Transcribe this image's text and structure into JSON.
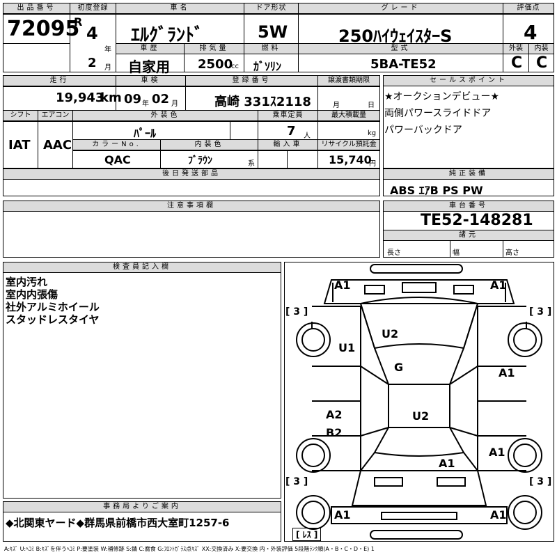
{
  "header": {
    "lot_label": "出品番号",
    "lot_number": "72095",
    "first_reg_label": "初度登録",
    "era": "R",
    "year": "4",
    "year_unit": "年",
    "month": "2",
    "month_unit": "月",
    "car_name_label": "車名",
    "car_name": "ｴﾙｸﾞﾗﾝﾄﾞ",
    "door_label": "ドア形状",
    "door": "5W",
    "grade_label": "グレード",
    "grade": "250ﾊｲｳｪｲｽﾀｰS",
    "score_label": "評価点",
    "score": "4",
    "history_label": "車歴",
    "history": "自家用",
    "displacement_label": "排気量",
    "displacement": "2500",
    "displacement_unit": "cc",
    "fuel_label": "燃料",
    "fuel": "ｶﾞｿﾘﾝ",
    "model_label": "型式",
    "model": "5BA-TE52",
    "exterior_label": "外装",
    "exterior": "C",
    "interior_label": "内装",
    "interior": "C"
  },
  "row2": {
    "mileage_label": "走行",
    "mileage": "19,943",
    "mileage_unit": "km",
    "inspection_label": "車検",
    "insp_year": "09",
    "insp_year_unit": "年",
    "insp_month": "02",
    "insp_month_unit": "月",
    "plate_label": "登録番号",
    "plate": "高崎 331ｽ2118",
    "transfer_label": "譲渡書類期限",
    "transfer_month": "月",
    "transfer_day": "日",
    "shift_label": "シフト",
    "shift": "IAT",
    "ac_label": "エアコン",
    "ac": "AAC",
    "color_label": "外装色",
    "color": "ﾊﾟｰﾙ",
    "capacity_label": "乗車定員",
    "capacity": "7",
    "capacity_unit": "人",
    "load_label": "最大積載量",
    "load_unit": "kg",
    "color_no_label": "カラーNo.",
    "color_no": "QAC",
    "int_color_label": "内装色",
    "int_color": "ﾌﾞﾗｳﾝ",
    "int_color_unit": "系",
    "import_label": "輸入車",
    "recycle_label": "リサイクル預託金",
    "recycle": "15,740",
    "recycle_unit": "円"
  },
  "sales": {
    "label": "セールスポイント",
    "lines": [
      "★オークションデビュー★",
      "両側パワースライドドア",
      "パワーバックドア"
    ]
  },
  "later_parts_label": "後日発送部品",
  "equipment": {
    "label": "純正装備",
    "value": "ABS ｴｱB PS PW"
  },
  "notes_label": "注意事項欄",
  "chassis": {
    "label": "車台番号",
    "value": "TE52-148281"
  },
  "specs": {
    "label": "諸元",
    "length": "長さ",
    "width": "幅",
    "height": "高さ"
  },
  "inspector": {
    "label": "検査員記入欄",
    "lines": [
      "室内汚れ",
      "室内内張傷",
      "社外アルミホイール",
      "スタッドレスタイヤ"
    ]
  },
  "office": {
    "label": "事務局よりご案内",
    "value": "◆北関東ヤード◆群馬県前橋市西大室町1257-6"
  },
  "diagram": {
    "marks": {
      "a1_tl": "A1",
      "a1_tr": "A1",
      "a1_bl": "A1",
      "a1_br": "A1",
      "u1": "U1",
      "u2_top": "U2",
      "g": "G",
      "a1_right_mid": "A1",
      "a2": "A2",
      "b2": "B2",
      "u2_mid": "U2",
      "a1_right_low": "A1",
      "a1_center_low": "A1",
      "tire_tl": "[ 3 ]",
      "tire_tr": "[ 3 ]",
      "tire_bl": "[ 3 ]",
      "tire_br": "[ 3 ]",
      "spare": "[ ﾚｽ ]"
    }
  },
  "legend": "A:ｷｽﾞ U:ﾍｺﾐ B:ｷｽﾞを伴うﾍｺﾐ P:要塗装 W:補修跡 S:錆 C:腐食 G:ﾌﾛﾝﾄｶﾞﾗｽ点ｷｽﾞ XX:交換済み X:要交換 内・外装評価 5段階ﾗﾝｸ順(A・B・C・D・E) 1"
}
